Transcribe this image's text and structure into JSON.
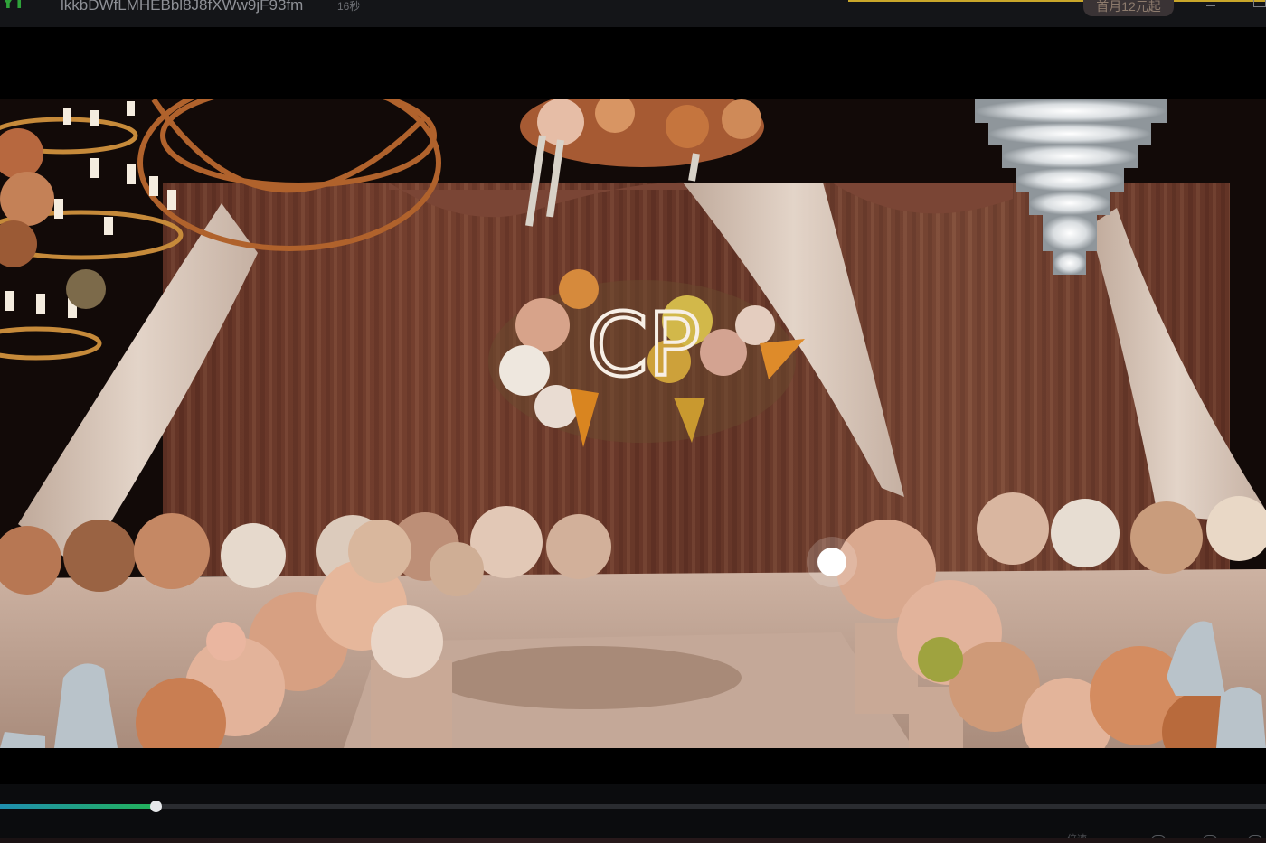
{
  "window": {
    "logo_text": "YT",
    "video_title": "lkkbDWfLMHEBbl8J8fXWw9jF93fm",
    "duration_label": "16秒",
    "promo_button": "首月12元起"
  },
  "player": {
    "progress_percent": 12.3,
    "control_hint": "倍速"
  },
  "video_frame": {
    "monogram": "CP"
  },
  "colors": {
    "accent_green": "#22b35a",
    "accent_blue": "#1f8fb0",
    "title_load_line": "#c9a62a",
    "curtain_brown": "#6b3a2a",
    "drape_cream": "#d9c8bb",
    "flower_peach": "#e0a07e",
    "flower_orange": "#d97a2b"
  },
  "icons": [
    "app-logo-icon",
    "minimize-icon",
    "maximize-icon",
    "speed-icon",
    "pip-icon"
  ]
}
